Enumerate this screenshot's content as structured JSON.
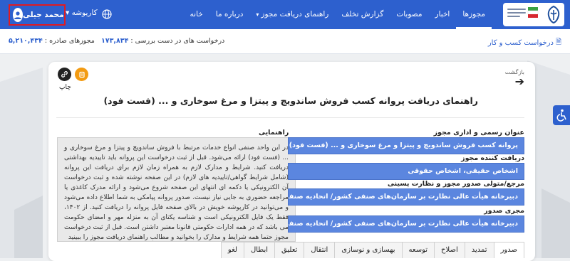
{
  "header": {
    "nav": [
      {
        "label": "خانه",
        "active": false,
        "dropdown": false
      },
      {
        "label": "درباره ما",
        "active": false,
        "dropdown": false
      },
      {
        "label": "راهنمای دریافت مجوز",
        "active": false,
        "dropdown": true
      },
      {
        "label": "گزارش تخلف",
        "active": false,
        "dropdown": false
      },
      {
        "label": "مصوبات",
        "active": false,
        "dropdown": false
      },
      {
        "label": "اخبار",
        "active": false,
        "dropdown": false
      },
      {
        "label": "مجوزها",
        "active": true,
        "dropdown": false
      }
    ],
    "kariosk_label": "کاریوشه",
    "user_name": "محمد جیلی",
    "colors": {
      "bar": "#2d60ce",
      "highlight_border": "#e01b22"
    }
  },
  "subbar": {
    "breadcrumb": "درخواست کسب و کار",
    "requests_label": "درخواست های در دست بررسی :",
    "requests_value": "۱۷۳,۸۳۴",
    "issued_label": "مجوزهای صادره :",
    "issued_value": "۵,۲۱۰,۴۳۴"
  },
  "card": {
    "back_label": "بازگشت",
    "print_label": "چاپ",
    "title": "راهنمای دریافت پروانه کسب فروش ساندویچ و پیتزا و مرغ سوخاری و ... (فست فود)",
    "guide_heading": "راهنمایی",
    "guide_text": "در این واحد صنفی انواع خدمات مرتبط با فروش ساندویچ و پیتزا و مرغ سوخاری و ... (فست فود) ارائه می‌شود. قبل از ثبت درخواست این پروانه باید تاییدیه بهداشتی دریافت کنید. شرایط و مدارک لازم به همراه زمان لازم برای دریافت این پروانه (شامل شرایط گواهی/تاییدیه های لازم) در این صفحه نوشته شده و ثبت درخواست آن الکترونیکی یا دکمه ای انتهای این صفحه شروع می‌شود و ارائه مدرک کاغذی یا مراجعه حضوری به جایی نیاز نیست. صدور پروانه پیامکی به شما اطلاع داده می‌شود و می‌توانید در کارپوشه خویش در بالای صفحه فایل پروانه را دریافت کنید. از ۱۴۰۲، فقط یک فایل الکترونیکی است و شناسه یکتای آن به منزله مهر و امضای حکومت می باشد که در همه ادارات حکومتی قانونا معتبر داشتن است. قبل از ثبت درخواست مجوز حتما همه شرایط و مدارک را بخوانید و مطالب راهنمای دریافت مجوز را ببینید",
    "fields": [
      {
        "label": "عنوان رسمی و اداری مجوز",
        "value": "پروانه کسب فروش ساندویچ و پیتزا و مرغ سوخاری و ... (فست فود)"
      },
      {
        "label": "دریافت کننده مجوز",
        "value": "اشخاص حقیقی، اشخاص حقوقی"
      },
      {
        "label": "مرجع/متولی صدور مجوز و نظارت پسینی",
        "value": "دبیرخانه هیأت عالی نظارت بر سازمان‌های صنفی کشور/ اتحادیه صنفی"
      },
      {
        "label": "مجری صدور",
        "value": "دبیرخانه هیأت عالی نظارت بر سازمان‌های صنفی کشور/ اتحادیه صنفی - اتحادیه استان/شهرستان"
      }
    ],
    "tabs": [
      {
        "label": "صدور",
        "active": true
      },
      {
        "label": "تمدید",
        "active": false
      },
      {
        "label": "اصلاح",
        "active": false
      },
      {
        "label": "توسعه",
        "active": false
      },
      {
        "label": "بهسازی و نوسازی",
        "active": false
      },
      {
        "label": "انتقال",
        "active": false
      },
      {
        "label": "تعلیق",
        "active": false
      },
      {
        "label": "ابطال",
        "active": false
      },
      {
        "label": "لغو",
        "active": false
      }
    ]
  },
  "icons": [
    "gov-emblem-icon",
    "globe-icon",
    "user-avatar-icon",
    "link-icon",
    "orange-copy-icon",
    "back-arrow-icon",
    "accessibility-icon",
    "chevron-down-icon"
  ]
}
